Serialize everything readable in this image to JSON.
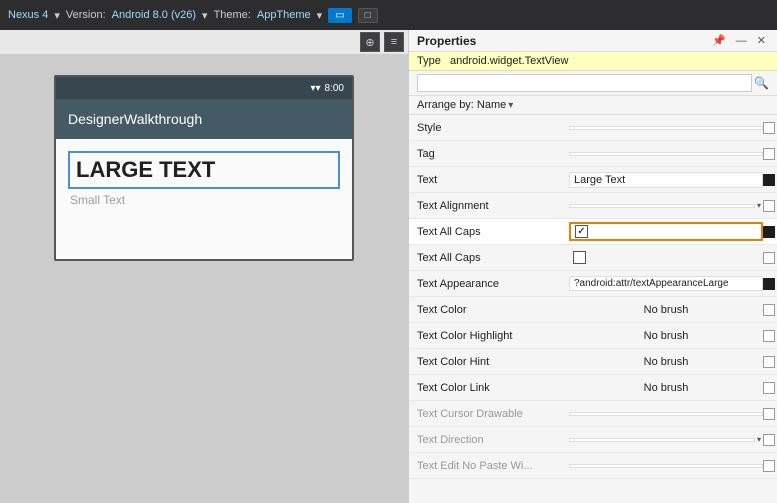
{
  "topbar": {
    "version_label": "Version:",
    "version_value": "Android 8.0 (v26)",
    "theme_label": "Theme:",
    "theme_value": "AppTheme",
    "phone_btn": "▭",
    "tablet_btn": "□",
    "time": "8:00",
    "dropdown_arrow": "▾"
  },
  "designer": {
    "app_name": "DesignerWalkthrough",
    "large_text": "LARGE TEXT",
    "small_text": "Small Text"
  },
  "properties": {
    "title": "Properties",
    "type_label": "Type",
    "type_value": "android.widget.TextView",
    "arrange_by": "Arrange by: Name",
    "search_placeholder": "",
    "rows": [
      {
        "name": "Style",
        "value": "",
        "type": "input",
        "end": "square"
      },
      {
        "name": "Tag",
        "value": "",
        "type": "input",
        "end": "square"
      },
      {
        "name": "Text",
        "value": "Large Text",
        "type": "input",
        "end": "black"
      },
      {
        "name": "Text Alignment",
        "value": "",
        "type": "dropdown",
        "end": "square"
      },
      {
        "name": "Text All Caps",
        "value": "checked",
        "type": "checkbox-orange",
        "end": "black"
      },
      {
        "name": "Text All Caps",
        "value": "",
        "type": "checkbox",
        "end": "square"
      },
      {
        "name": "Text Appearance",
        "value": "?android:attr/textAppearanceLarge",
        "type": "input-long",
        "end": "black"
      },
      {
        "name": "Text Color",
        "value": "No brush",
        "type": "no-brush",
        "end": "square"
      },
      {
        "name": "Text Color Highlight",
        "value": "No brush",
        "type": "no-brush",
        "end": "square"
      },
      {
        "name": "Text Color Hint",
        "value": "No brush",
        "type": "no-brush",
        "end": "square"
      },
      {
        "name": "Text Color Link",
        "value": "No brush",
        "type": "no-brush",
        "end": "square"
      },
      {
        "name": "Text Cursor Drawable",
        "value": "",
        "type": "input",
        "end": "square"
      },
      {
        "name": "Text Direction",
        "value": "",
        "type": "dropdown",
        "end": "square"
      },
      {
        "name": "Text Edit No Paste Wi...",
        "value": "",
        "type": "input",
        "end": "square"
      }
    ]
  }
}
